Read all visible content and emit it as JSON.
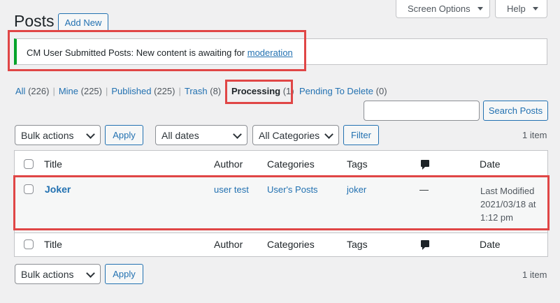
{
  "header": {
    "title": "Posts",
    "add_new": "Add New",
    "screen_options": "Screen Options",
    "help": "Help"
  },
  "notice": {
    "text": "CM User Submitted Posts: New content is awaiting for ",
    "link": "moderation",
    "accent_color": "#00a32a"
  },
  "status_filters": [
    {
      "label": "All",
      "count": "(226)"
    },
    {
      "label": "Mine",
      "count": "(225)"
    },
    {
      "label": "Published",
      "count": "(225)"
    },
    {
      "label": "Trash",
      "count": "(8)"
    },
    {
      "label": "Processing",
      "count": "(1)"
    },
    {
      "label": "Pending To Delete",
      "count": "(0)"
    }
  ],
  "search": {
    "value": "",
    "button": "Search Posts"
  },
  "tablenav_top": {
    "bulk_actions": "Bulk actions",
    "apply": "Apply",
    "dates": "All dates",
    "categories": "All Categories",
    "filter": "Filter",
    "count": "1 item"
  },
  "table": {
    "columns": {
      "title": "Title",
      "author": "Author",
      "categories": "Categories",
      "tags": "Tags",
      "comments_icon": "comment-icon",
      "date": "Date"
    },
    "rows": [
      {
        "title": "Joker",
        "author": "user test",
        "categories": "User's Posts",
        "tags": "joker",
        "comments": "—",
        "date_line1": "Last Modified",
        "date_line2": "2021/03/18 at",
        "date_line3": "1:12 pm"
      }
    ]
  },
  "tablenav_bottom": {
    "bulk_actions": "Bulk actions",
    "apply": "Apply",
    "count": "1 item"
  },
  "colors": {
    "link": "#2271b1",
    "highlight": "#e04646",
    "background": "#f0f0f1"
  }
}
